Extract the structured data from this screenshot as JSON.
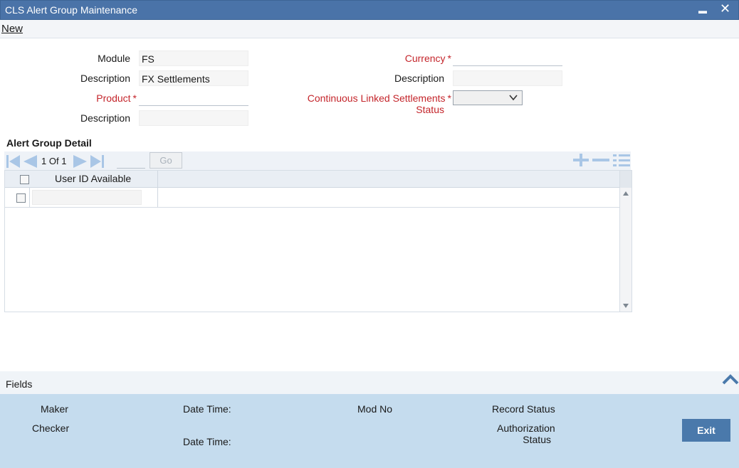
{
  "window": {
    "title": "CLS Alert Group Maintenance",
    "minimize": "▬",
    "close": "✕"
  },
  "menu": {
    "new": "New"
  },
  "form": {
    "module_label": "Module",
    "module_value": "FS",
    "module_desc_label": "Description",
    "module_desc_value": "FX Settlements",
    "product_label": "Product",
    "product_value": "",
    "product_desc_label": "Description",
    "product_desc_value": "",
    "currency_label": "Currency",
    "currency_value": "",
    "currency_desc_label": "Description",
    "currency_desc_value": "",
    "cls_status_label_line1": "Continuous Linked Settlements",
    "cls_status_label_line2": "Status",
    "cls_status_value": "",
    "required_mark": "*"
  },
  "alert_group": {
    "title": "Alert Group Detail",
    "page_current": "1",
    "page_of": "Of",
    "page_total": "1",
    "go_label": "Go",
    "columns": [
      "User ID Available"
    ],
    "rows": [
      {
        "user_id": ""
      }
    ]
  },
  "fields_bar": {
    "label": "Fields"
  },
  "audit": {
    "maker": "Maker",
    "maker_datetime": "Date Time:",
    "mod_no": "Mod No",
    "record_status": "Record Status",
    "checker": "Checker",
    "checker_datetime": "Date Time:",
    "auth_status_line1": "Authorization",
    "auth_status_line2": "Status",
    "exit": "Exit"
  },
  "colors": {
    "title_bar": "#4a73a8",
    "required_red": "#c4252b",
    "footer": "#c5dcee",
    "exit_button": "#4a79ab",
    "nav_icons": "#a9c6e6"
  },
  "icons": [
    "first-page-icon",
    "prev-page-icon",
    "next-page-icon",
    "last-page-icon",
    "add-row-icon",
    "delete-row-icon",
    "single-view-icon",
    "collapse-chevron-icon",
    "dropdown-chevron-icon",
    "scroll-up-icon",
    "scroll-down-icon"
  ]
}
